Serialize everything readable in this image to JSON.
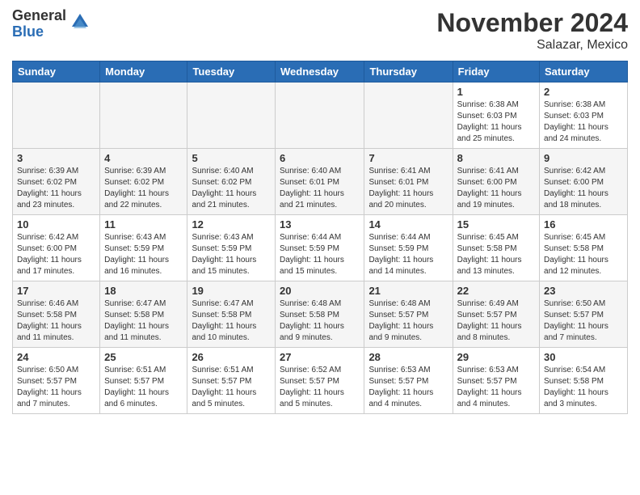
{
  "header": {
    "logo_general": "General",
    "logo_blue": "Blue",
    "month_title": "November 2024",
    "location": "Salazar, Mexico"
  },
  "days_of_week": [
    "Sunday",
    "Monday",
    "Tuesday",
    "Wednesday",
    "Thursday",
    "Friday",
    "Saturday"
  ],
  "weeks": [
    [
      {
        "day": "",
        "info": ""
      },
      {
        "day": "",
        "info": ""
      },
      {
        "day": "",
        "info": ""
      },
      {
        "day": "",
        "info": ""
      },
      {
        "day": "",
        "info": ""
      },
      {
        "day": "1",
        "info": "Sunrise: 6:38 AM\nSunset: 6:03 PM\nDaylight: 11 hours\nand 25 minutes."
      },
      {
        "day": "2",
        "info": "Sunrise: 6:38 AM\nSunset: 6:03 PM\nDaylight: 11 hours\nand 24 minutes."
      }
    ],
    [
      {
        "day": "3",
        "info": "Sunrise: 6:39 AM\nSunset: 6:02 PM\nDaylight: 11 hours\nand 23 minutes."
      },
      {
        "day": "4",
        "info": "Sunrise: 6:39 AM\nSunset: 6:02 PM\nDaylight: 11 hours\nand 22 minutes."
      },
      {
        "day": "5",
        "info": "Sunrise: 6:40 AM\nSunset: 6:02 PM\nDaylight: 11 hours\nand 21 minutes."
      },
      {
        "day": "6",
        "info": "Sunrise: 6:40 AM\nSunset: 6:01 PM\nDaylight: 11 hours\nand 21 minutes."
      },
      {
        "day": "7",
        "info": "Sunrise: 6:41 AM\nSunset: 6:01 PM\nDaylight: 11 hours\nand 20 minutes."
      },
      {
        "day": "8",
        "info": "Sunrise: 6:41 AM\nSunset: 6:00 PM\nDaylight: 11 hours\nand 19 minutes."
      },
      {
        "day": "9",
        "info": "Sunrise: 6:42 AM\nSunset: 6:00 PM\nDaylight: 11 hours\nand 18 minutes."
      }
    ],
    [
      {
        "day": "10",
        "info": "Sunrise: 6:42 AM\nSunset: 6:00 PM\nDaylight: 11 hours\nand 17 minutes."
      },
      {
        "day": "11",
        "info": "Sunrise: 6:43 AM\nSunset: 5:59 PM\nDaylight: 11 hours\nand 16 minutes."
      },
      {
        "day": "12",
        "info": "Sunrise: 6:43 AM\nSunset: 5:59 PM\nDaylight: 11 hours\nand 15 minutes."
      },
      {
        "day": "13",
        "info": "Sunrise: 6:44 AM\nSunset: 5:59 PM\nDaylight: 11 hours\nand 15 minutes."
      },
      {
        "day": "14",
        "info": "Sunrise: 6:44 AM\nSunset: 5:59 PM\nDaylight: 11 hours\nand 14 minutes."
      },
      {
        "day": "15",
        "info": "Sunrise: 6:45 AM\nSunset: 5:58 PM\nDaylight: 11 hours\nand 13 minutes."
      },
      {
        "day": "16",
        "info": "Sunrise: 6:45 AM\nSunset: 5:58 PM\nDaylight: 11 hours\nand 12 minutes."
      }
    ],
    [
      {
        "day": "17",
        "info": "Sunrise: 6:46 AM\nSunset: 5:58 PM\nDaylight: 11 hours\nand 11 minutes."
      },
      {
        "day": "18",
        "info": "Sunrise: 6:47 AM\nSunset: 5:58 PM\nDaylight: 11 hours\nand 11 minutes."
      },
      {
        "day": "19",
        "info": "Sunrise: 6:47 AM\nSunset: 5:58 PM\nDaylight: 11 hours\nand 10 minutes."
      },
      {
        "day": "20",
        "info": "Sunrise: 6:48 AM\nSunset: 5:58 PM\nDaylight: 11 hours\nand 9 minutes."
      },
      {
        "day": "21",
        "info": "Sunrise: 6:48 AM\nSunset: 5:57 PM\nDaylight: 11 hours\nand 9 minutes."
      },
      {
        "day": "22",
        "info": "Sunrise: 6:49 AM\nSunset: 5:57 PM\nDaylight: 11 hours\nand 8 minutes."
      },
      {
        "day": "23",
        "info": "Sunrise: 6:50 AM\nSunset: 5:57 PM\nDaylight: 11 hours\nand 7 minutes."
      }
    ],
    [
      {
        "day": "24",
        "info": "Sunrise: 6:50 AM\nSunset: 5:57 PM\nDaylight: 11 hours\nand 7 minutes."
      },
      {
        "day": "25",
        "info": "Sunrise: 6:51 AM\nSunset: 5:57 PM\nDaylight: 11 hours\nand 6 minutes."
      },
      {
        "day": "26",
        "info": "Sunrise: 6:51 AM\nSunset: 5:57 PM\nDaylight: 11 hours\nand 5 minutes."
      },
      {
        "day": "27",
        "info": "Sunrise: 6:52 AM\nSunset: 5:57 PM\nDaylight: 11 hours\nand 5 minutes."
      },
      {
        "day": "28",
        "info": "Sunrise: 6:53 AM\nSunset: 5:57 PM\nDaylight: 11 hours\nand 4 minutes."
      },
      {
        "day": "29",
        "info": "Sunrise: 6:53 AM\nSunset: 5:57 PM\nDaylight: 11 hours\nand 4 minutes."
      },
      {
        "day": "30",
        "info": "Sunrise: 6:54 AM\nSunset: 5:58 PM\nDaylight: 11 hours\nand 3 minutes."
      }
    ]
  ]
}
